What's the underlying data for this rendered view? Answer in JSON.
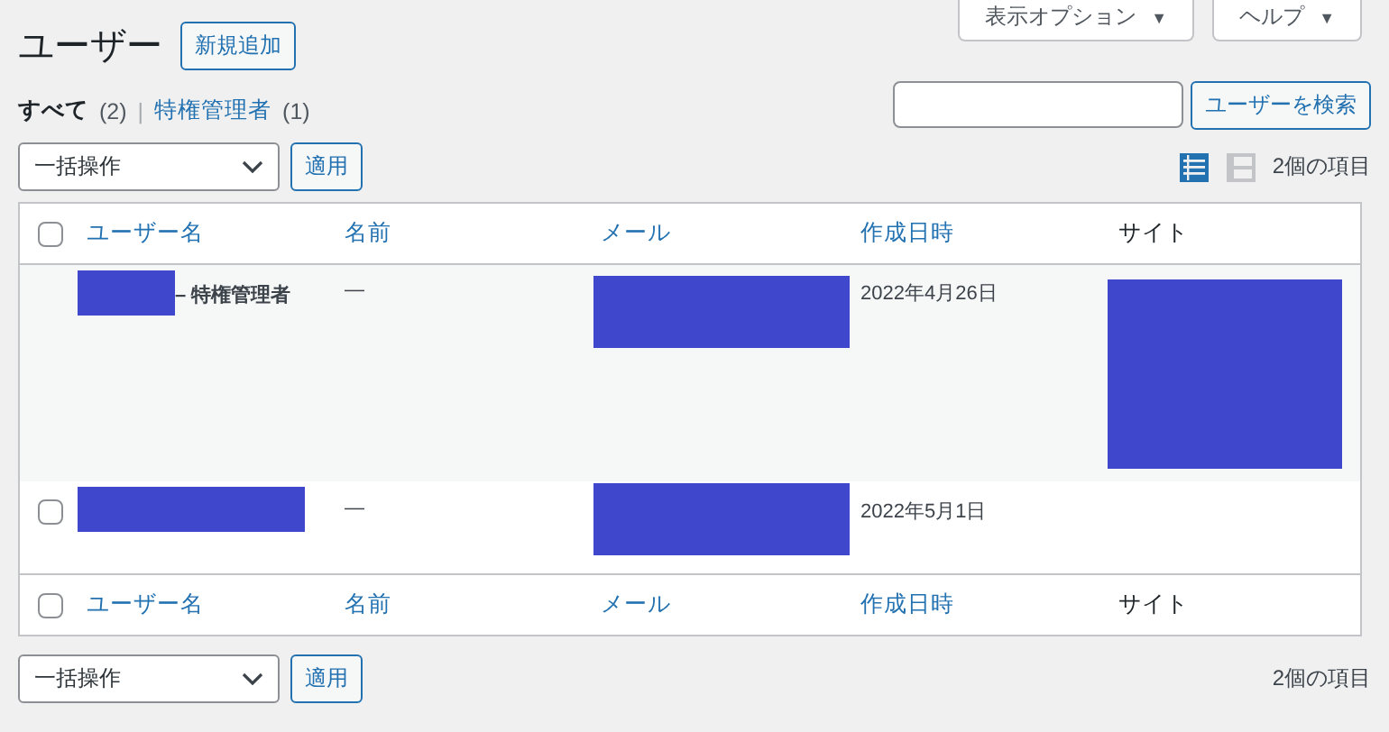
{
  "screen_tabs": [
    {
      "label": "表示オプション",
      "caret": "▼"
    },
    {
      "label": "ヘルプ",
      "caret": "▼"
    }
  ],
  "title": "ユーザー",
  "add_button": "新規追加",
  "filters": [
    {
      "label": "すべて",
      "count": "(2)",
      "selected": true
    },
    {
      "label": "特権管理者",
      "count": "(1)",
      "selected": false
    }
  ],
  "filter_separator": "|",
  "search": {
    "button": "ユーザーを検索"
  },
  "bulk_top": {
    "select": "一括操作",
    "apply": "適用"
  },
  "view_modes": [
    {
      "kind": "list",
      "selected": true
    },
    {
      "kind": "excerpt",
      "selected": false
    }
  ],
  "item_count_top": "2個の項目",
  "table": {
    "header": {
      "select_all_checked": false,
      "columns": [
        "ユーザー名",
        "名前",
        "メール",
        "作成日時",
        "サイト"
      ]
    },
    "footer": {
      "select_all_checked": false,
      "columns": [
        "ユーザー名",
        "名前",
        "メール",
        "作成日時",
        "サイト"
      ]
    },
    "rows": [
      {
        "has_checkbox": false,
        "username_redacted": true,
        "role": "– 特権管理者",
        "name": "—",
        "email_redacted": true,
        "created": "2022年4月26日",
        "site_redacted": true
      },
      {
        "has_checkbox": true,
        "checked": false,
        "username_redacted": true,
        "name": "—",
        "email_redacted": true,
        "created": "2022年5月1日",
        "site_redacted": false
      }
    ]
  },
  "bulk_bottom": {
    "select": "一括操作",
    "apply": "適用"
  },
  "item_count_bottom": "2個の項目"
}
